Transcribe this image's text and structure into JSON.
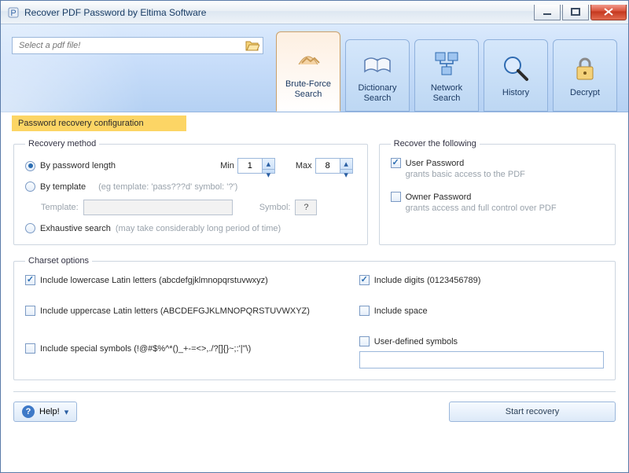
{
  "window": {
    "title": "Recover PDF Password by Eltima Software"
  },
  "filePicker": {
    "placeholder": "Select a pdf file!"
  },
  "tabs": {
    "bruteForce": "Brute-Force Search",
    "dictionary": "Dictionary Search",
    "network": "Network Search",
    "history": "History",
    "decrypt": "Decrypt"
  },
  "sectionTitle": "Password recovery configuration",
  "recovery": {
    "legend": "Recovery method",
    "byLength": "By password length",
    "minLabel": "Min",
    "minValue": "1",
    "maxLabel": "Max",
    "maxValue": "8",
    "byTemplate": "By template",
    "templateHint": "(eg template: 'pass???d' symbol: '?')",
    "templateLabel": "Template:",
    "templateValue": "",
    "symbolLabel": "Symbol:",
    "symbolValue": "?",
    "exhaustive": "Exhaustive search",
    "exhaustiveHint": "(may take considerably long period of time)"
  },
  "recoverFollowing": {
    "legend": "Recover the following",
    "userPassword": "User Password",
    "userDesc": "grants basic access to the PDF",
    "ownerPassword": "Owner Password",
    "ownerDesc": "grants access and full control over PDF"
  },
  "charset": {
    "legend": "Charset options",
    "lowercase": "Include lowercase Latin letters (abcdefgjklmnopqrstuvwxyz)",
    "uppercase": "Include uppercase Latin letters (ABCDEFGJKLMNOPQRSTUVWXYZ)",
    "special": "Include special symbols (!@#$%^*()_+-=<>,./?[]{}~;:'|\"\\)",
    "digits": "Include digits (0123456789)",
    "space": "Include space",
    "userDefined": "User-defined symbols",
    "userDefinedValue": ""
  },
  "buttons": {
    "help": "Help!",
    "start": "Start recovery"
  }
}
